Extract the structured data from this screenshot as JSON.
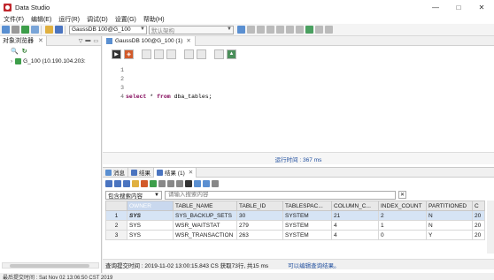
{
  "window": {
    "title": "Data Studio",
    "minimize": "—",
    "maximize": "□",
    "close": "✕"
  },
  "menu": [
    "文件(F)",
    "编辑(E)",
    "运行(R)",
    "调试(D)",
    "设置(G)",
    "帮助(H)"
  ],
  "toolbar": {
    "connection": "GaussDB 100@G_100",
    "schema": "默认架构"
  },
  "left_pane": {
    "tab": "对象浏览器",
    "tree_item": "G_100 (10.190.104.203:"
  },
  "editor": {
    "tab": "GaussDB 100@G_100 (1)",
    "lines": [
      "1",
      "2",
      "3",
      "4"
    ],
    "sql_kw1": "select",
    "sql_star": " * ",
    "sql_kw2": "from",
    "sql_rest": " dba_tables;",
    "runtime": "运行时间 : 367 ms"
  },
  "results": {
    "tabs": [
      "消息",
      "结果",
      "结果 (1)"
    ],
    "search_scope": "包含搜索内容",
    "search_placeholder": "请输入搜索内容",
    "columns": [
      "OWNER",
      "TABLE_NAME",
      "TABLE_ID",
      "TABLESPAC...",
      "COLUMN_C...",
      "INDEX_COUNT",
      "PARTITIONED",
      "C"
    ],
    "rows": [
      [
        "1",
        "SYS",
        "SYS_BACKUP_SETS",
        "30",
        "SYSTEM",
        "21",
        "2",
        "N",
        "20"
      ],
      [
        "2",
        "SYS",
        "WSR_WAITSTAT",
        "279",
        "SYSTEM",
        "4",
        "1",
        "N",
        "20"
      ],
      [
        "3",
        "SYS",
        "WSR_TRANSACTION",
        "263",
        "SYSTEM",
        "4",
        "0",
        "Y",
        "20"
      ]
    ],
    "status": "查询提交时间 : 2019-11-02 13:00:15.843 CS 获取73行, 共15 ms",
    "status_link": "可以编辑查询结果。"
  },
  "bottom": "最后提交时间 : Sat Nov 02 13:06:50 CST 2019"
}
